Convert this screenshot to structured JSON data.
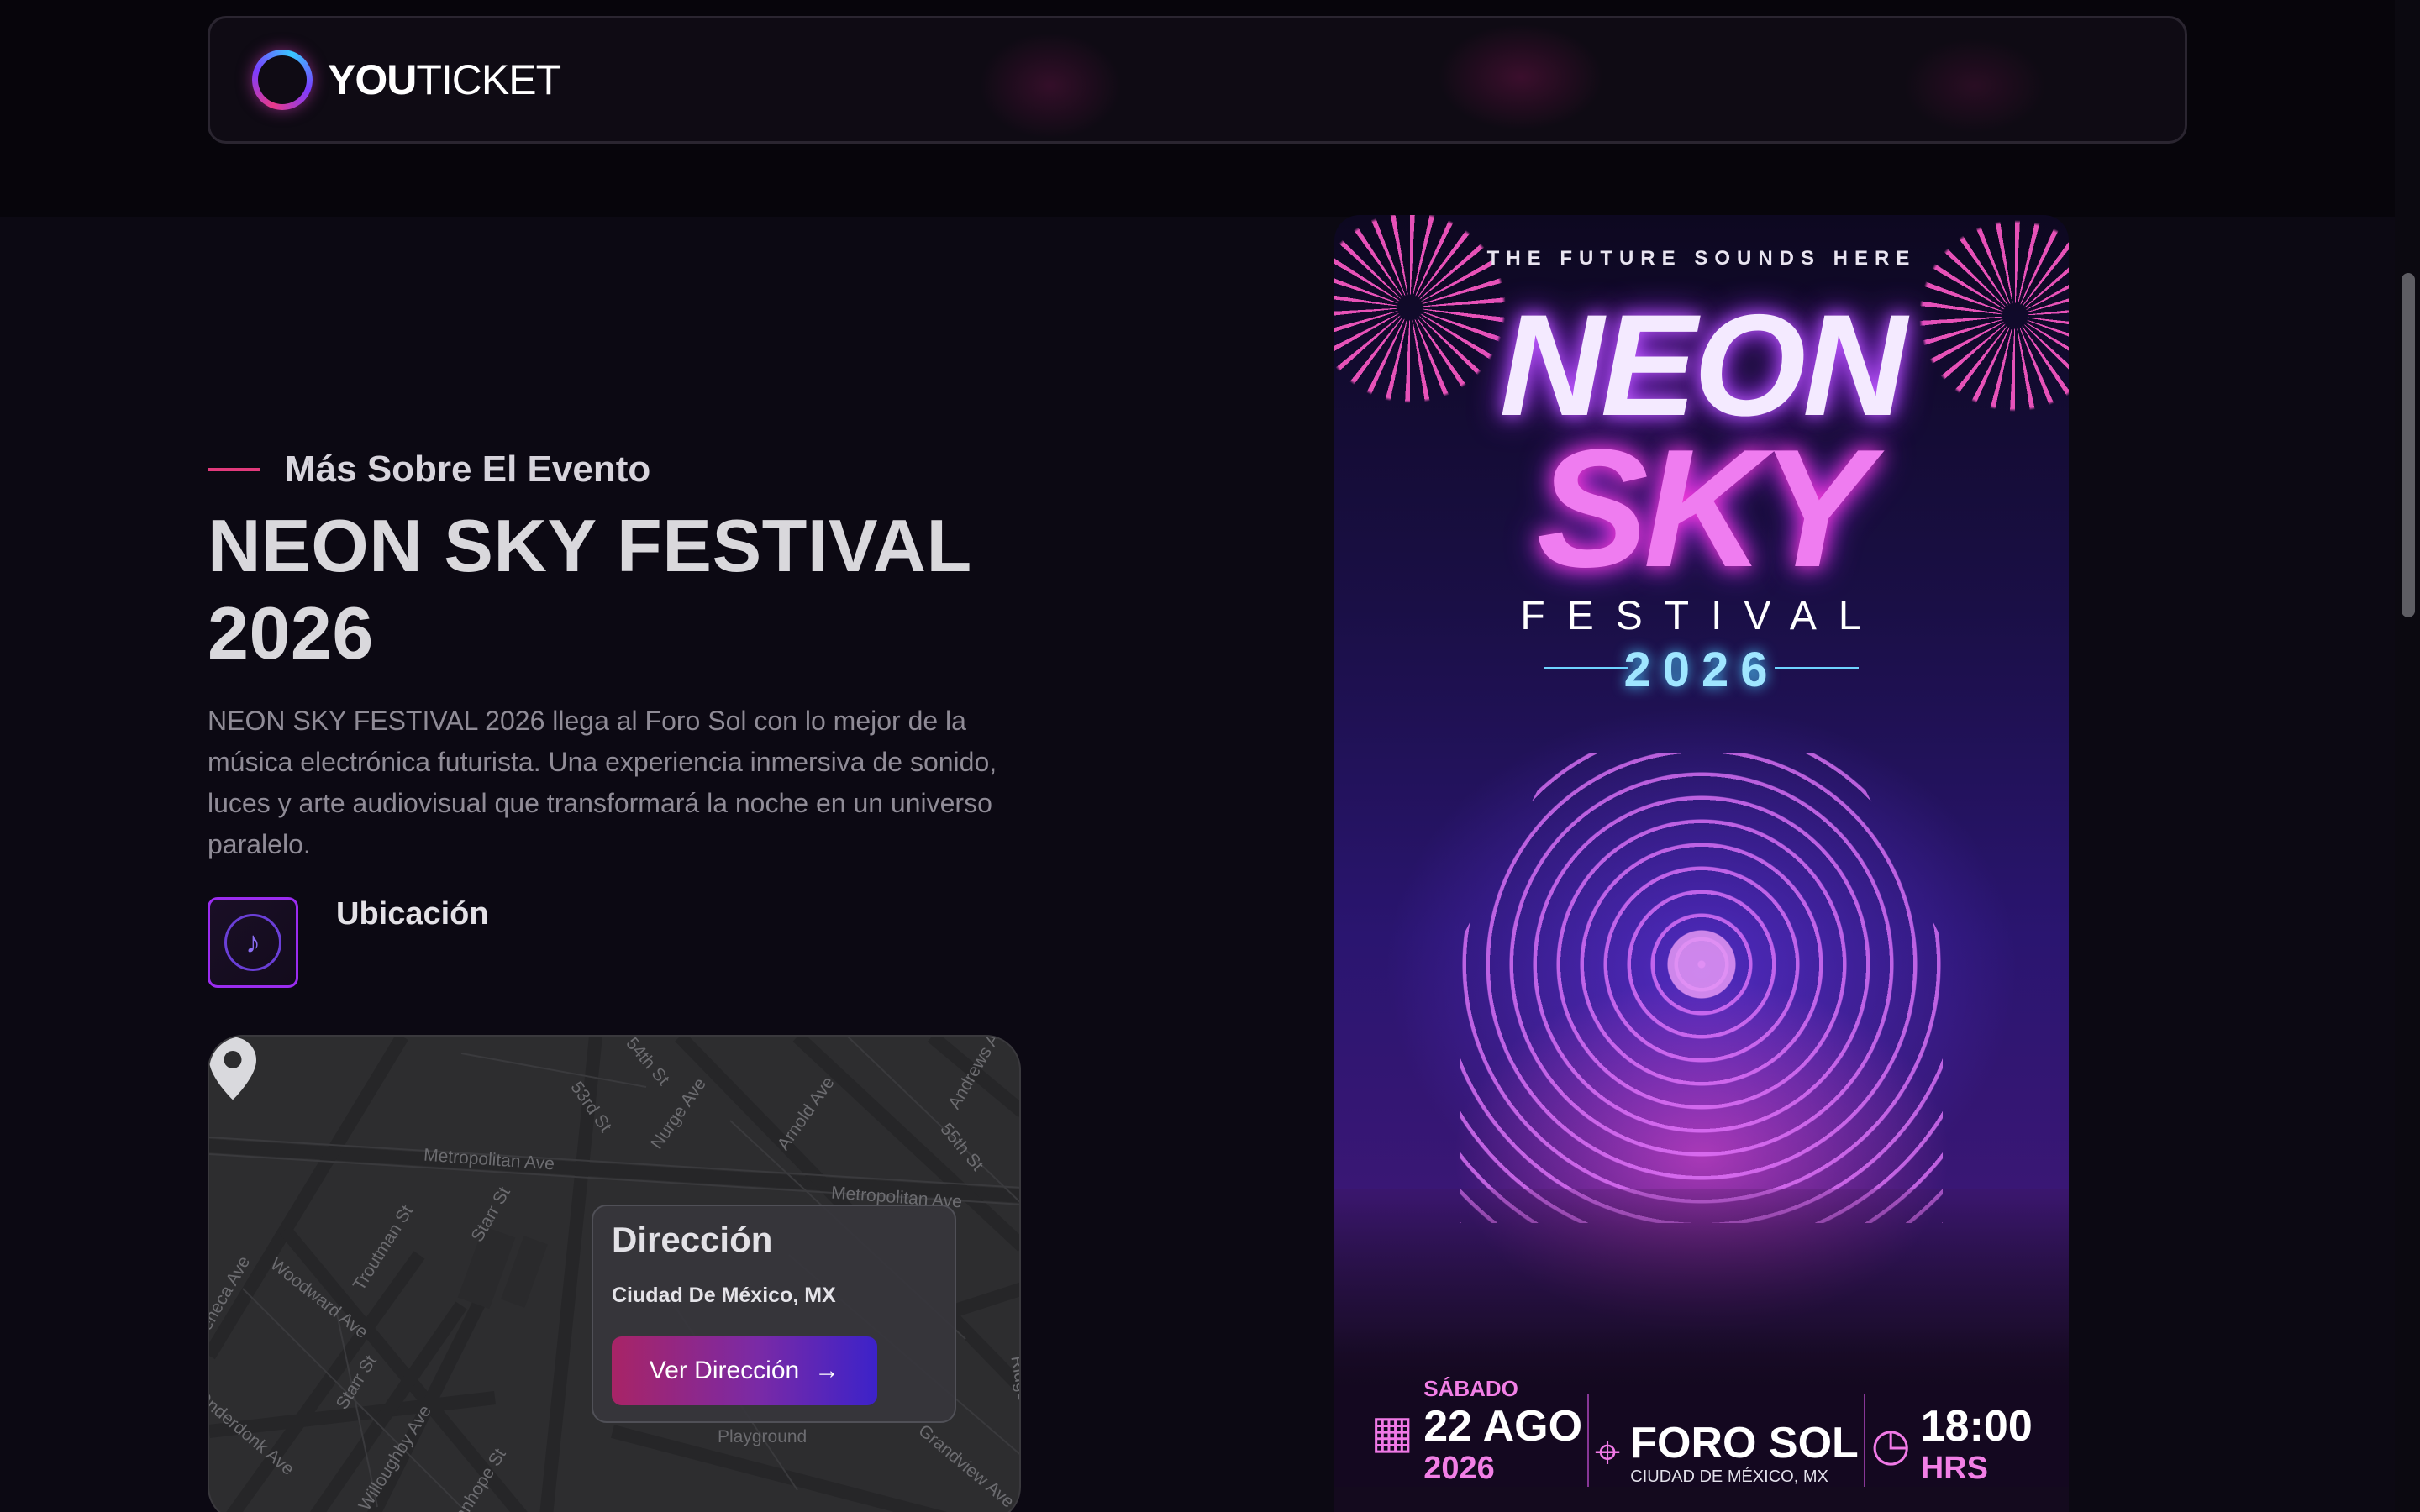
{
  "header": {
    "logo_bold": "YOU",
    "logo_light": "TICKET"
  },
  "about": {
    "eyebrow": "Más Sobre El Evento",
    "title": "NEON SKY FESTIVAL 2026",
    "description": "NEON SKY FESTIVAL 2026 llega al Foro Sol con lo mejor de la música electrónica futurista. Una experiencia inmersiva de sonido, luces y arte audiovisual que transformará la noche en un universo paralelo.",
    "location_label": "Ubicación"
  },
  "map": {
    "streets": [
      "54th St",
      "53rd St",
      "Nurge Ave",
      "Arnold Ave",
      "Andrews Ave",
      "55th St",
      "Metropolitan Ave",
      "Metropolitan Ave",
      "Troutman St",
      "Starr St",
      "Woodward Ave",
      "Starr St",
      "Willoughby Ave",
      "Seneca Ave",
      "Playground",
      "Grandview Ave",
      "Ridgewood Ave",
      "Onderdonk Ave",
      "Stanhope St"
    ],
    "popup_title": "Dirección",
    "popup_address": "Ciudad De México, MX",
    "popup_button": "Ver Dirección",
    "popup_button_arrow": "→"
  },
  "poster": {
    "tagline": "THE FUTURE SOUNDS HERE",
    "line1": "NEON",
    "line2": "SKY",
    "line3": "FESTIVAL",
    "year": "2026",
    "day": "SÁBADO",
    "date": "22 AGO",
    "date_year": "2026",
    "venue": "FORO SOL",
    "venue_city": "CIUDAD DE MÉXICO, MX",
    "time": "18:00",
    "time_unit": "HRS"
  },
  "colors": {
    "accent_pink": "#e23a7c",
    "accent_purple": "#9b2cf0",
    "background": "#0c0913"
  },
  "icons": [
    "logo-ring-icon",
    "music-pin-icon",
    "map-pin-icon",
    "arrow-right-icon",
    "calendar-icon",
    "location-pin-icon",
    "stopwatch-icon"
  ]
}
